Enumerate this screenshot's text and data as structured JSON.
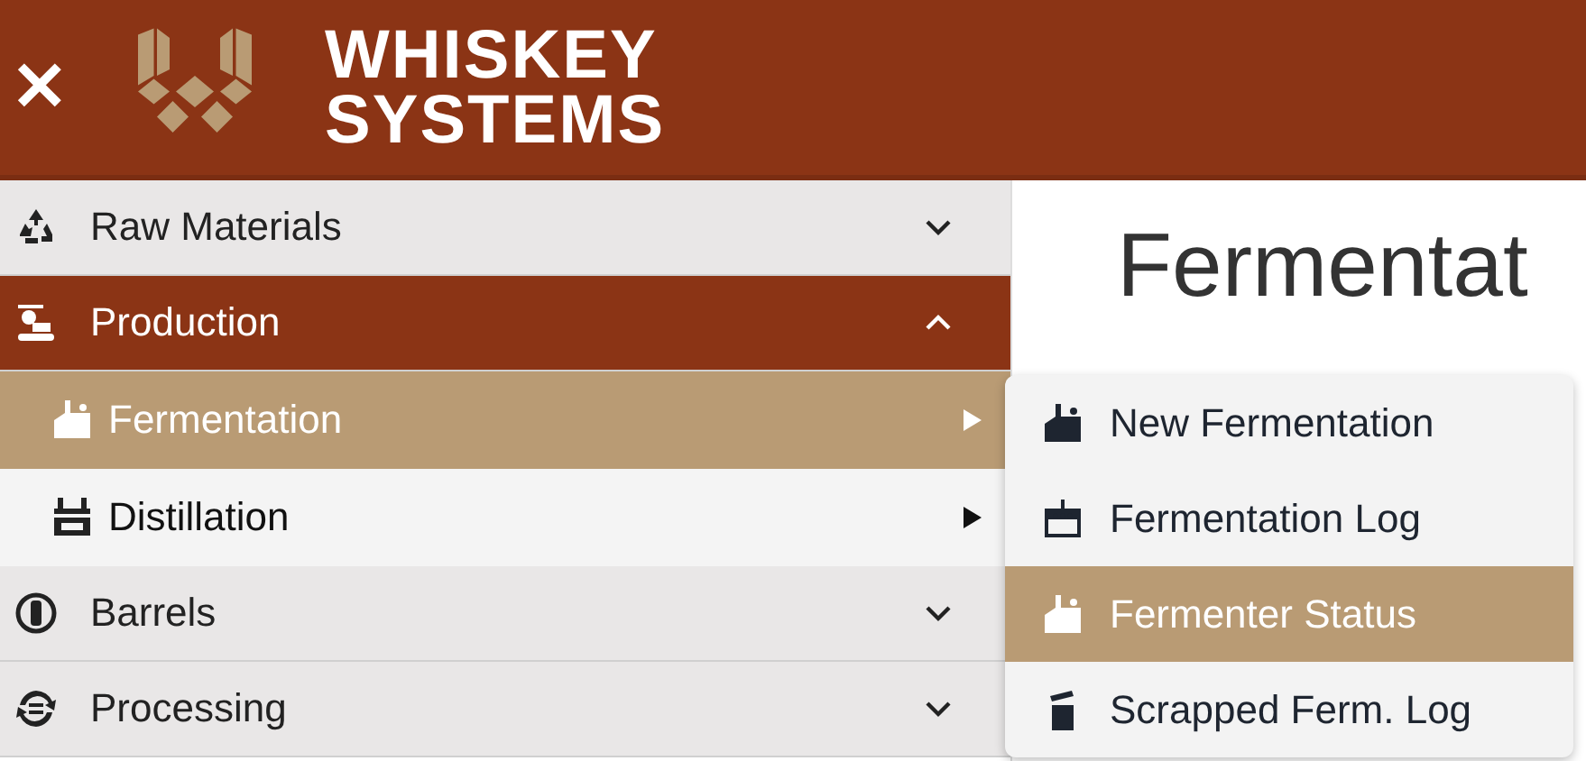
{
  "header": {
    "close": "✕",
    "logo_line_1": "WHISKEY",
    "logo_line_2": "SYSTEMS"
  },
  "sidebar": {
    "items": [
      {
        "label": "Raw Materials",
        "expanded": false,
        "selected": false
      },
      {
        "label": "Production",
        "expanded": true,
        "selected": true,
        "children": [
          {
            "label": "Fermentation",
            "selected": true
          },
          {
            "label": "Distillation",
            "selected": false
          }
        ]
      },
      {
        "label": "Barrels",
        "expanded": false,
        "selected": false
      },
      {
        "label": "Processing",
        "expanded": false,
        "selected": false
      }
    ]
  },
  "main": {
    "heading": "Fermentat"
  },
  "submenu": {
    "items": [
      {
        "label": "New Fermentation",
        "selected": false
      },
      {
        "label": "Fermentation Log",
        "selected": false
      },
      {
        "label": "Fermenter Status",
        "selected": true
      },
      {
        "label": "Scrapped Ferm. Log",
        "selected": false
      }
    ]
  }
}
